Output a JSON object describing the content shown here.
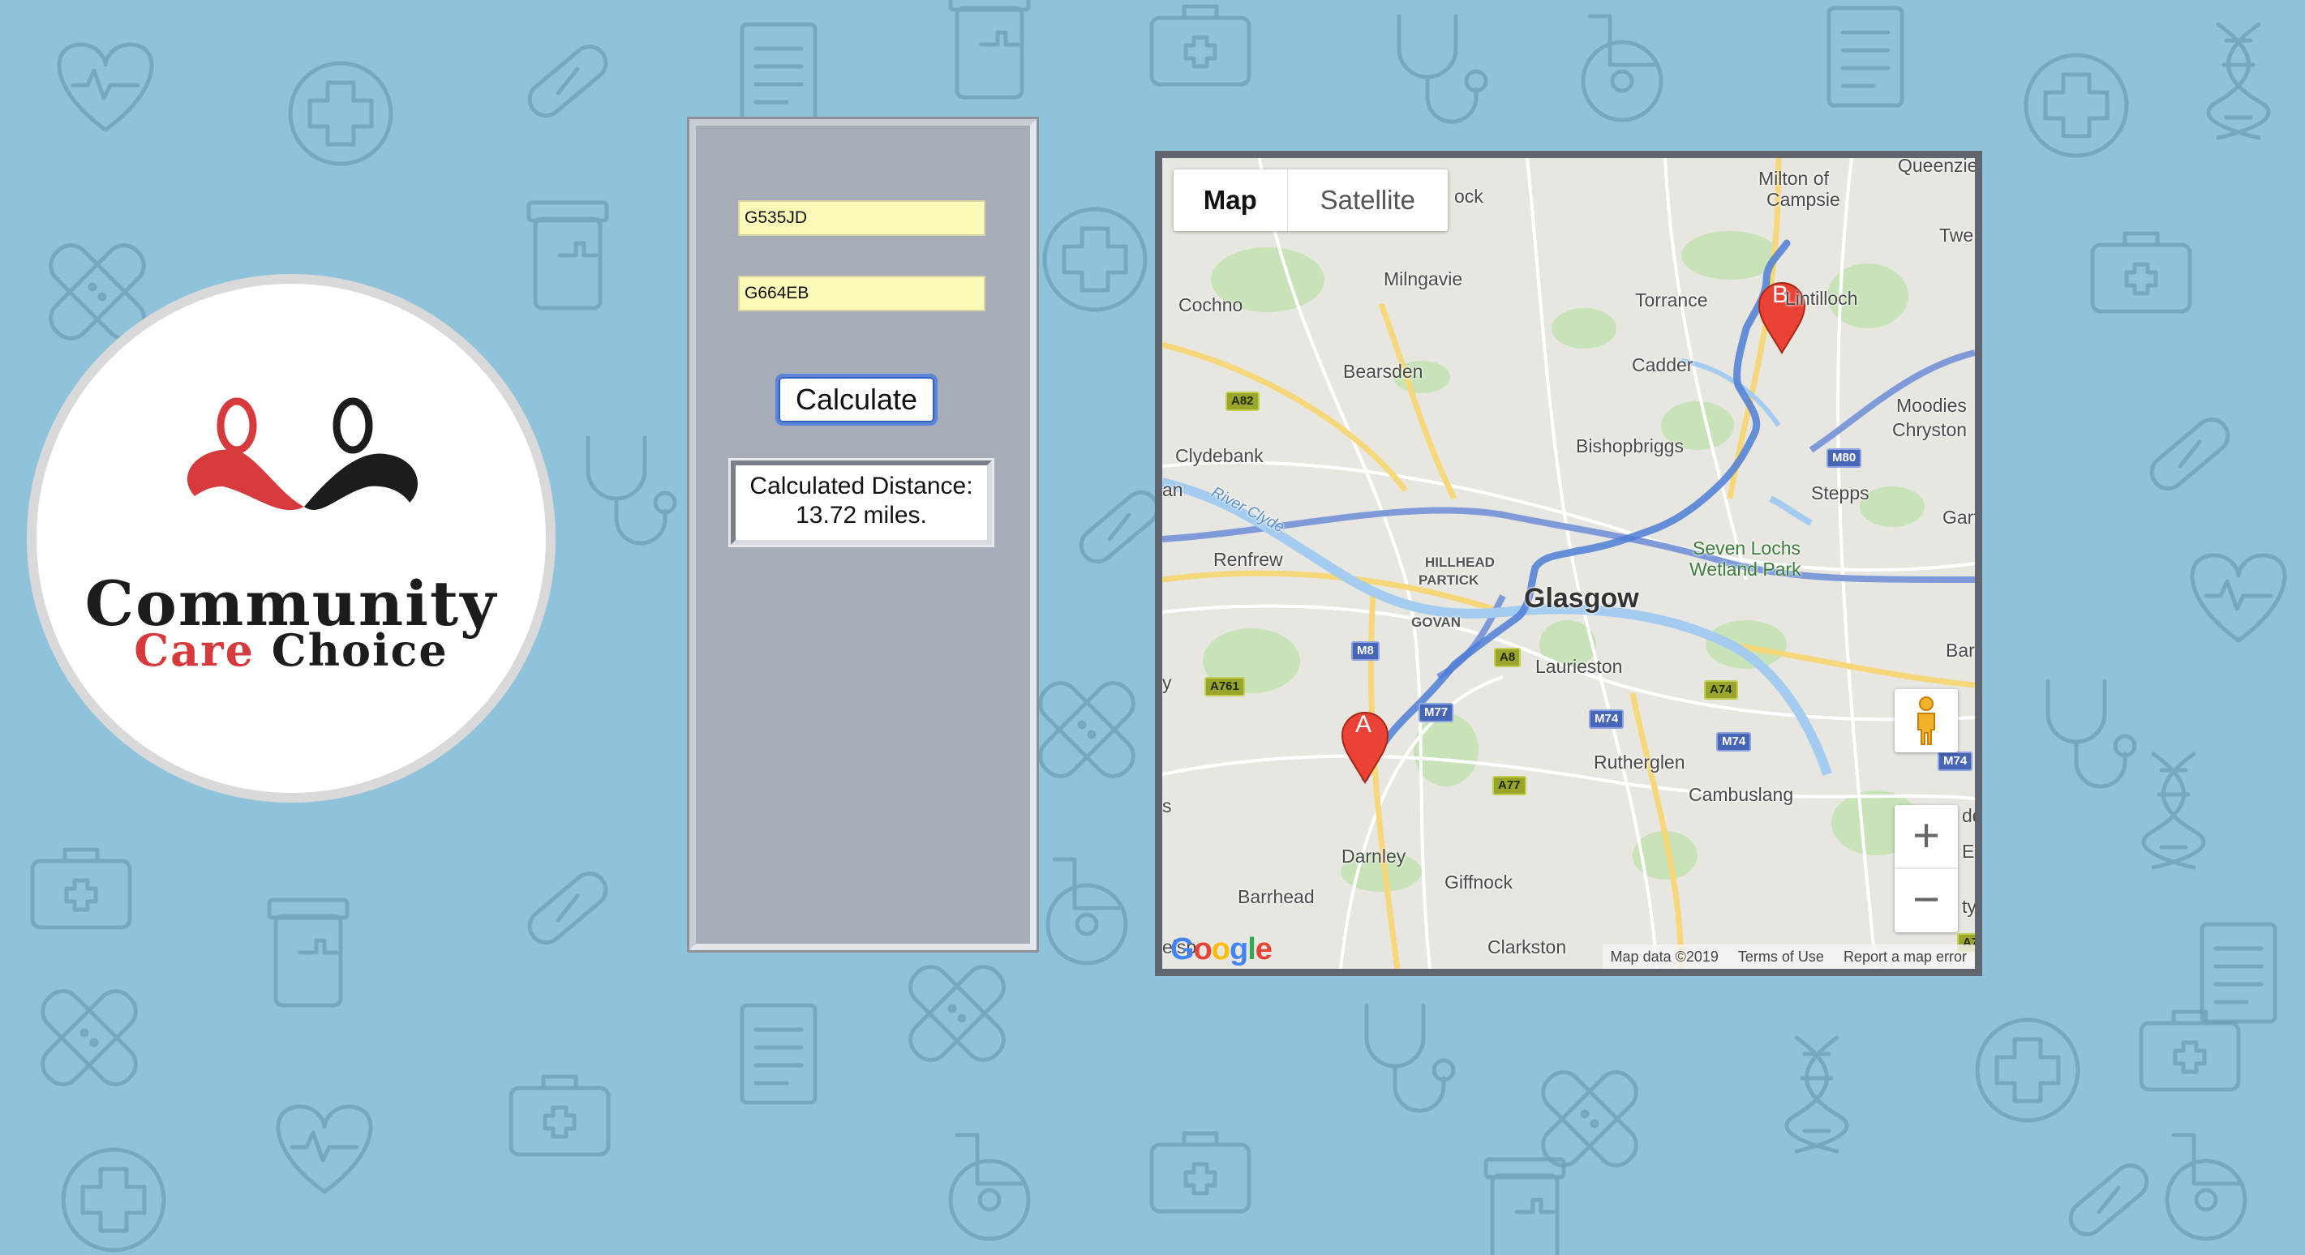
{
  "logo": {
    "line1": "Community",
    "line2_word1": "Care",
    "line2_word2": "Choice"
  },
  "form": {
    "origin_value": "G535JD",
    "destination_value": "G664EB",
    "calculate_label": "Calculate",
    "result_label": "Calculated Distance:",
    "result_value": "13.72 miles."
  },
  "map": {
    "type_map": "Map",
    "type_satellite": "Satellite",
    "marker_a": "A",
    "marker_b": "B",
    "zoom_in": "+",
    "zoom_out": "−",
    "google": "Google",
    "attribution": {
      "map_data": "Map data ©2019",
      "terms": "Terms of Use",
      "report": "Report a map error"
    },
    "places": {
      "milton": "Milton of",
      "campsie": "Campsie",
      "queenzie": "Queenzie",
      "twe": "Twe",
      "ock": "ock",
      "milngavie": "Milngavie",
      "cochno": "Cochno",
      "torrance": "Torrance",
      "lintilloch": "Lintilloch",
      "bearsden": "Bearsden",
      "cadder": "Cadder",
      "moodies": "Moodies",
      "chryston": "Chryston",
      "clydebank": "Clydebank",
      "bishopbriggs": "Bishopbriggs",
      "stepps": "Stepps",
      "an": "an",
      "gart": "Gart",
      "river_clyde": "River Clyde",
      "seven_lochs_1": "Seven Lochs",
      "seven_lochs_2": "Wetland Park",
      "renfrew": "Renfrew",
      "hillhead": "HILLHEAD",
      "partick": "PARTICK",
      "glasgow": "Glasgow",
      "govan": "GOVAN",
      "bar": "Bar",
      "laurieston": "Laurieston",
      "y": "y",
      "rutherglen": "Rutherglen",
      "cambuslang": "Cambuslang",
      "s": "s",
      "darnley": "Darnley",
      "barrhead": "Barrhead",
      "giffnock": "Giffnock",
      "clarkston": "Clarkston",
      "dd": "dd",
      "e": "E",
      "ty": "ty",
      "elsp": "elsp"
    },
    "shields": {
      "a82": "A82",
      "m80": "M80",
      "m8": "M8",
      "a8": "A8",
      "a761": "A761",
      "m77": "M77",
      "m74a": "M74",
      "m74b": "M74",
      "m74c": "M74",
      "a74": "A74",
      "a77": "A77",
      "a7x": "A7"
    }
  }
}
